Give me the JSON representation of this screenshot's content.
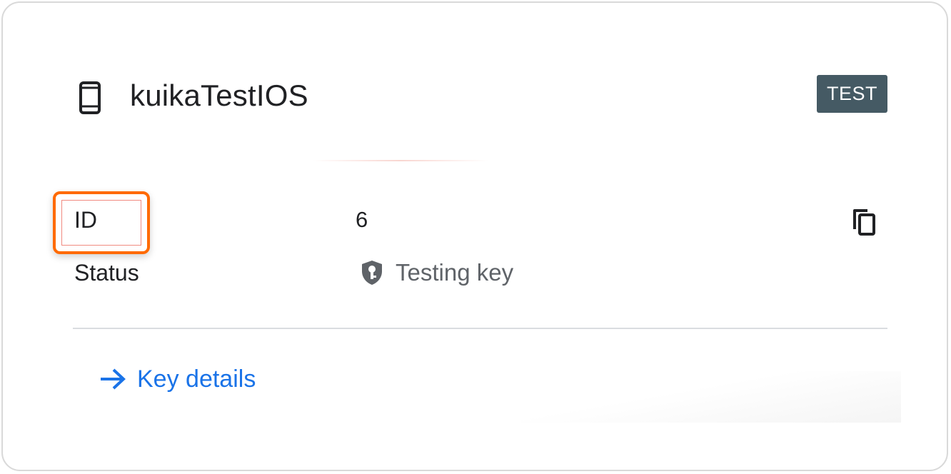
{
  "app": {
    "name": "kuikaTestIOS",
    "platform_icon": "smartphone-icon",
    "environment_badge": "TEST"
  },
  "fields": {
    "id": {
      "label": "ID",
      "value": "6",
      "copy_icon": "copy-icon"
    },
    "status": {
      "label": "Status",
      "icon": "key-shield-icon",
      "value": "Testing key"
    }
  },
  "actions": {
    "key_details": {
      "icon": "arrow-right-icon",
      "label": "Key details"
    }
  },
  "colors": {
    "badge_background": "#455a64",
    "link": "#1a73e8",
    "highlight": "#ff6a00",
    "primary_text": "#202124",
    "secondary_text": "#5f6368"
  }
}
